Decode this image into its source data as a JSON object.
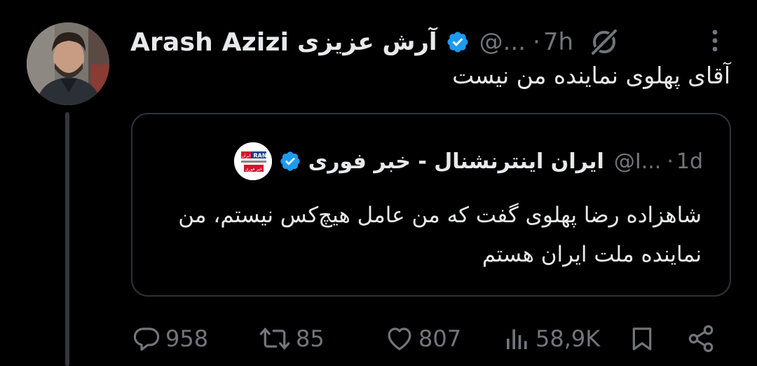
{
  "author": {
    "name": "Arash Azizi",
    "name_fa": "آرش عزیزی",
    "handle": "@...",
    "separator": "·",
    "time": "7h"
  },
  "tweet": {
    "text": "آقای پهلوی نماینده من نیست"
  },
  "quoted": {
    "name": "ایران اینترنشنال - خبر فوری",
    "handle": "@I...",
    "separator": "·",
    "time": "1d",
    "text": "شاهزاده رضا پهلوی گفت که من عامل هیچ‌کس نیستم، من نماینده ملت ایران هستم",
    "avatar_logo_text_top": "RAN",
    "avatar_logo_text_mid": "ایران",
    "avatar_logo_text_bottom": "خبر فوری"
  },
  "actions": {
    "replies": "958",
    "retweets": "85",
    "likes": "807",
    "views": "58,9K"
  },
  "icons": [
    "verified-badge-icon",
    "grok-icon",
    "more-icon",
    "reply-icon",
    "retweet-icon",
    "like-icon",
    "views-icon",
    "bookmark-icon",
    "share-icon"
  ],
  "colors": {
    "background": "#000000",
    "text": "#e7e9ea",
    "muted": "#71767b",
    "verified": "#1d9bf0",
    "border": "#2f3336"
  }
}
